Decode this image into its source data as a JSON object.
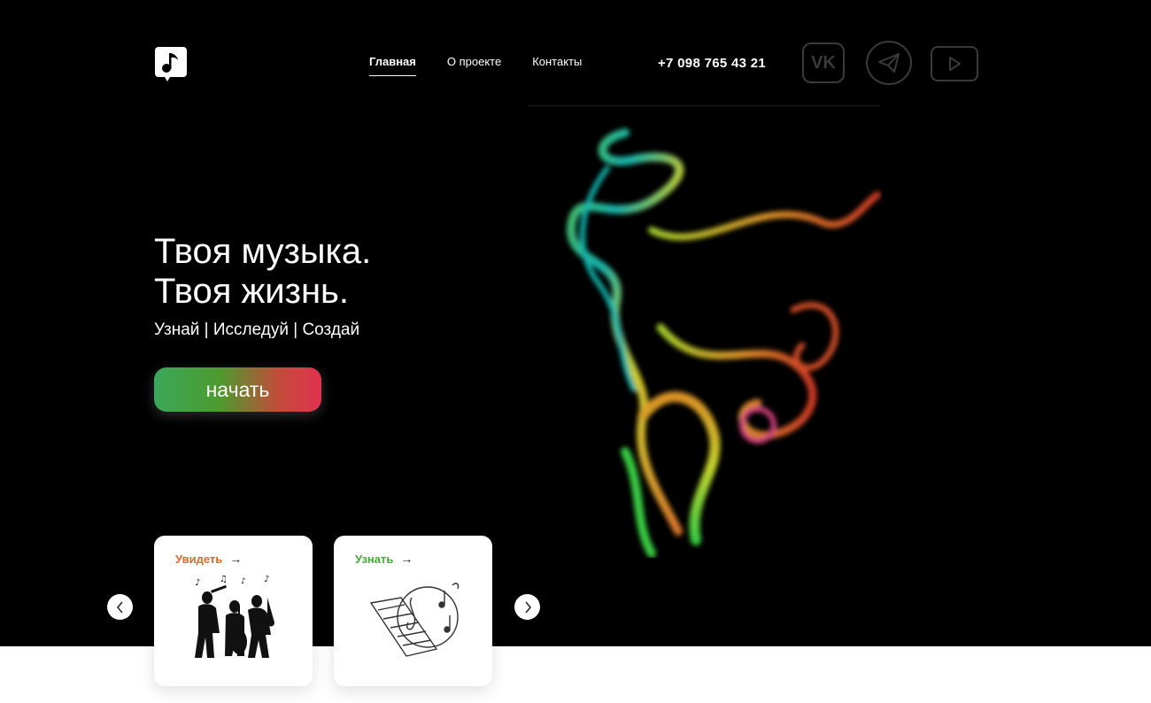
{
  "header": {
    "logo_icon": "music-note-icon",
    "nav": [
      {
        "label": "Главная",
        "active": true
      },
      {
        "label": "О проекте",
        "active": false
      },
      {
        "label": "Контакты",
        "active": false
      }
    ],
    "phone": "+7 098 765 43 21",
    "social": {
      "vk_label": "VK",
      "telegram_icon": "telegram-icon",
      "youtube_icon": "youtube-icon"
    }
  },
  "hero": {
    "title_line1": "Твоя музыка.",
    "title_line2": "Твоя жизнь.",
    "subtitle": "Узнай | Исследуй | Создай",
    "cta_label": "начать"
  },
  "cards": [
    {
      "link_label": "Увидеть",
      "arrow": "→",
      "link_color": "#e06a2b",
      "illustration": "jazz-band-silhouette"
    },
    {
      "link_label": "Узнать",
      "arrow": "→",
      "link_color": "#46a83b",
      "illustration": "piano-notes-sketch"
    }
  ],
  "carousel": {
    "prev_icon": "chevron-left-icon",
    "next_icon": "chevron-right-icon"
  },
  "colors": {
    "background": "#000000",
    "text": "#ffffff",
    "cta_start": "#3aa85a",
    "cta_end": "#e0334f"
  }
}
